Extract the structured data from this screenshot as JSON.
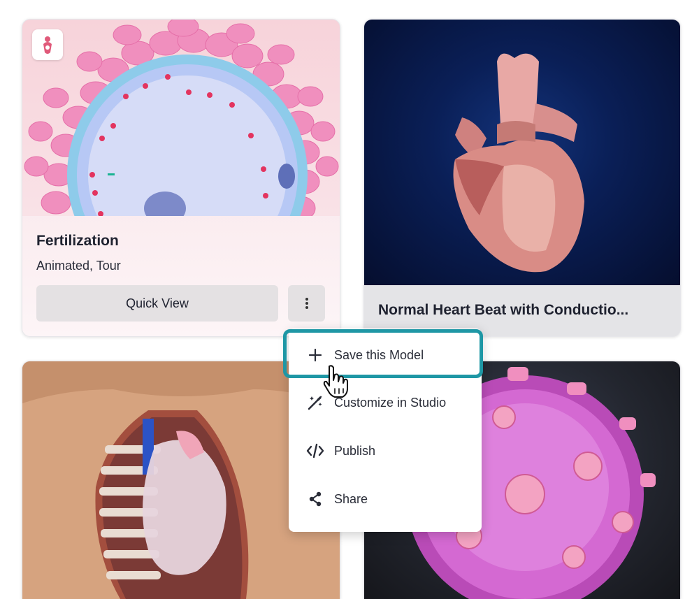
{
  "cards": [
    {
      "title": "Fertilization",
      "subtitle": "Animated, Tour",
      "quick_view_label": "Quick View",
      "badge_icon": "fertilization-icon",
      "accent": "#e05a7a"
    },
    {
      "title": "Normal Heart Beat with Conductio..."
    },
    {},
    {}
  ],
  "menu": {
    "items": [
      {
        "label": "Save this Model",
        "icon": "plus-icon"
      },
      {
        "label": "Customize in Studio",
        "icon": "magic-wand-icon"
      },
      {
        "label": "Publish",
        "icon": "code-icon"
      },
      {
        "label": "Share",
        "icon": "share-icon"
      }
    ],
    "highlight_color": "#1e97a5"
  }
}
